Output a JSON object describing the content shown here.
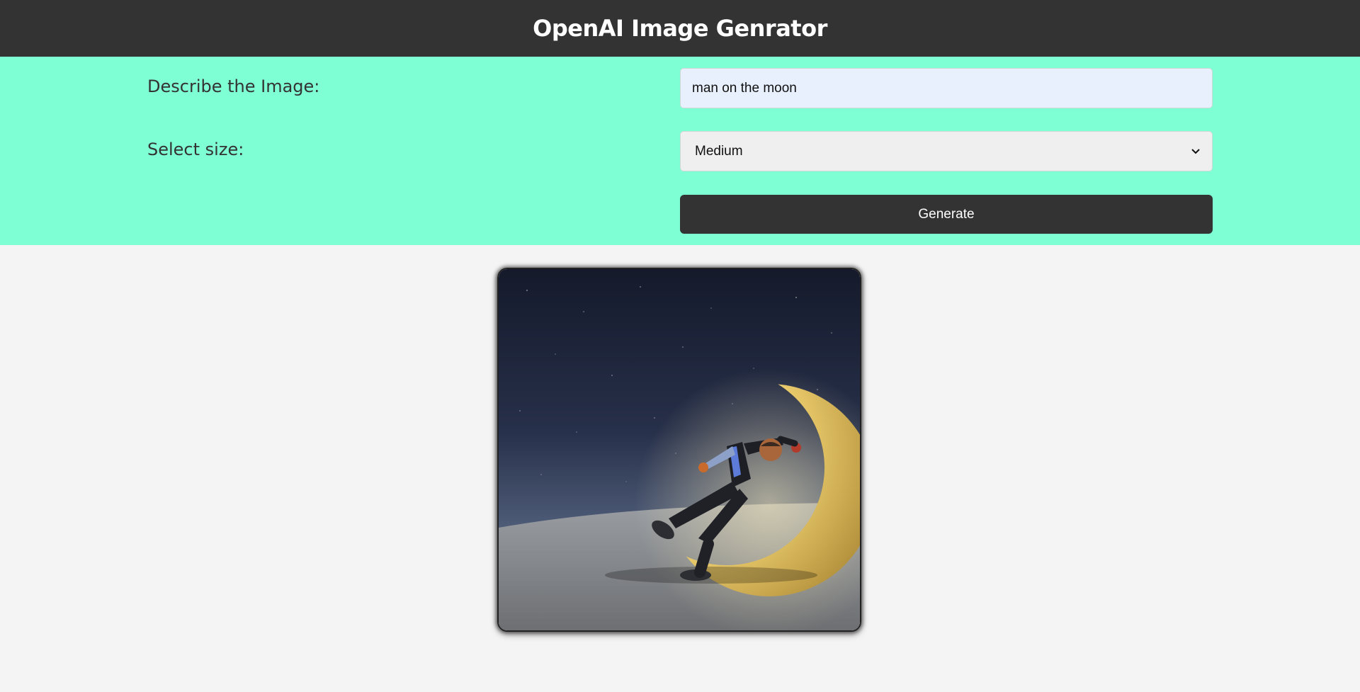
{
  "header": {
    "title": "OpenAI Image Genrator"
  },
  "form": {
    "describe_label": "Describe the Image:",
    "describe_value": "man on the moon",
    "size_label": "Select size:",
    "size_selected": "Medium",
    "generate_label": "Generate"
  },
  "image": {
    "alt": "man on the moon"
  },
  "colors": {
    "header_bg": "#333333",
    "form_bg": "#7fffd4",
    "page_bg": "#f4f4f4",
    "input_bg": "#e8f0fe",
    "button_bg": "#333333"
  }
}
